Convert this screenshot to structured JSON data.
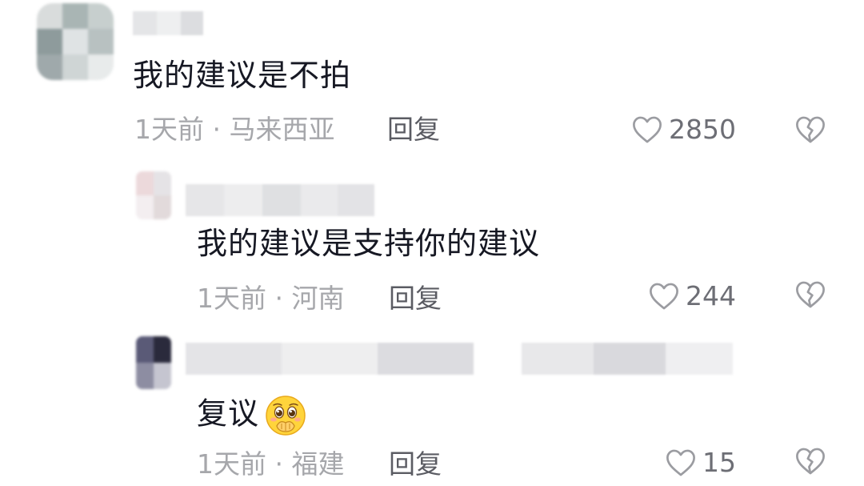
{
  "comments": [
    {
      "text": "我的建议是不拍",
      "time": "1天前",
      "separator": "·",
      "location": "马来西亚",
      "reply_label": "回复",
      "likes": "2850",
      "avatar_colors": [
        "#d9dcdc",
        "#a9b5b4",
        "#c7cfce",
        "#8e9b9c",
        "#dfe3e4",
        "#b8c1c1",
        "#9fa9ab",
        "#cfd5d5",
        "#e8ebeb"
      ],
      "username_colors": [
        "#e4e5e7",
        "#eeeff0",
        "#dcdde0"
      ]
    },
    {
      "text": "我的建议是支持你的建议",
      "time": "1天前",
      "separator": "·",
      "location": "河南",
      "reply_label": "回复",
      "likes": "244",
      "avatar_colors": [
        "#ecd9db",
        "#e5e3e6",
        "#f3eef0",
        "#e2dadb"
      ],
      "username_colors": [
        "#e6e6e8",
        "#ededee",
        "#dfe0e2",
        "#eaeaec",
        "#e3e3e6"
      ]
    },
    {
      "text": "复议",
      "emoji": "covering-mouth-emoji",
      "time": "1天前",
      "separator": "·",
      "location": "福建",
      "reply_label": "回复",
      "likes": "15",
      "avatar_colors": [
        "#5a5a77",
        "#2a2a3c",
        "#8d8da2",
        "#c5c5d0"
      ],
      "username_colors": [
        "#e4e4e7",
        "#eeeeef",
        "#dcdce0",
        "#e8e8ea",
        "#d9d9dd",
        "#efeff1"
      ]
    }
  ],
  "colors": {
    "text_primary": "#161823",
    "text_meta": "#a6a7ab",
    "reply": "#5b5c63",
    "icon": "#9b9ca1"
  }
}
